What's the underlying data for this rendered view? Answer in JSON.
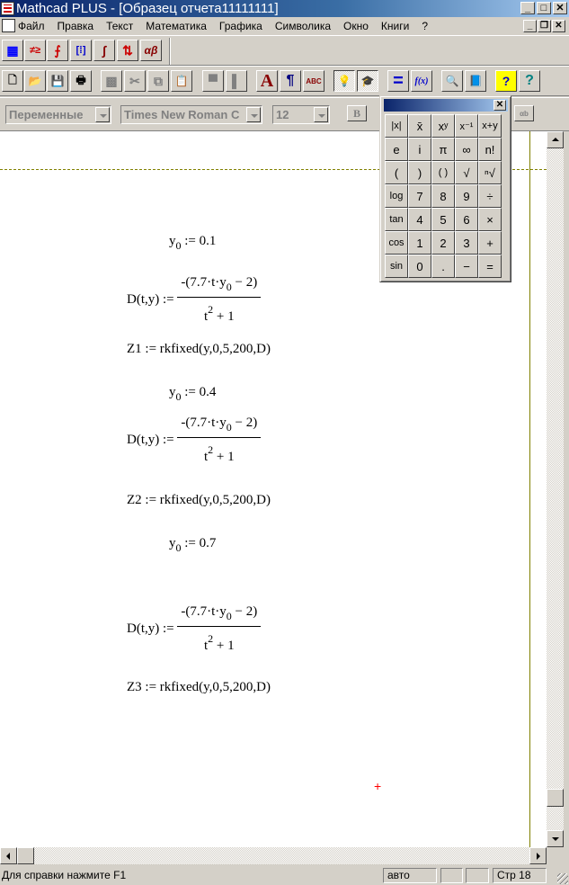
{
  "window": {
    "title": "Mathcad PLUS - [Образец  отчета11111111]",
    "controls": {
      "minimize": "_",
      "maximize": "□",
      "close": "✕"
    },
    "mdi_controls": {
      "minimize": "_",
      "restore": "❐",
      "close": "✕"
    }
  },
  "menu": {
    "items": [
      {
        "label": "Файл"
      },
      {
        "label": "Правка"
      },
      {
        "label": "Текст"
      },
      {
        "label": "Математика"
      },
      {
        "label": "Графика"
      },
      {
        "label": "Символика"
      },
      {
        "label": "Окно"
      },
      {
        "label": "Книги"
      },
      {
        "label": "?"
      }
    ]
  },
  "math_toolbar": {
    "buttons": [
      {
        "icon": "calculator-icon",
        "glyph": "▦"
      },
      {
        "icon": "evaluation-icon",
        "glyph": "≠≥"
      },
      {
        "icon": "graph-icon",
        "glyph": "⨍"
      },
      {
        "icon": "matrix-icon",
        "glyph": "[⁞]"
      },
      {
        "icon": "calculus-icon",
        "glyph": "∫"
      },
      {
        "icon": "programming-icon",
        "glyph": "⇅"
      },
      {
        "icon": "greek-icon",
        "glyph": "αβ"
      }
    ]
  },
  "standard_toolbar": {
    "buttons": [
      {
        "icon": "new-icon",
        "glyph": "🗋"
      },
      {
        "icon": "open-icon",
        "glyph": "📂"
      },
      {
        "icon": "save-icon",
        "glyph": "💾"
      },
      {
        "icon": "print-icon",
        "glyph": "🖶"
      },
      {
        "icon": "check-spelling-region-icon",
        "glyph": "▩"
      },
      {
        "icon": "cut-icon",
        "glyph": "✂"
      },
      {
        "icon": "copy-icon",
        "glyph": "⧉"
      },
      {
        "icon": "paste-icon",
        "glyph": "📋"
      },
      {
        "icon": "align-across-icon",
        "glyph": "▀"
      },
      {
        "icon": "align-down-icon",
        "glyph": "▌"
      },
      {
        "icon": "text-style-icon",
        "glyph": "A"
      },
      {
        "icon": "paragraph-icon",
        "glyph": "¶"
      },
      {
        "icon": "spellcheck-icon",
        "glyph": "ABC"
      },
      {
        "icon": "lightbulb-icon",
        "glyph": "💡"
      },
      {
        "icon": "tutor-icon",
        "glyph": "🎓"
      },
      {
        "icon": "calculate-icon",
        "glyph": "="
      },
      {
        "icon": "function-icon",
        "glyph": "f(x)"
      },
      {
        "icon": "zoom-icon",
        "glyph": "🔍"
      },
      {
        "icon": "resource-icon",
        "glyph": "📘"
      },
      {
        "icon": "help-context-icon",
        "glyph": "?"
      },
      {
        "icon": "help-icon",
        "glyph": "?"
      }
    ]
  },
  "format_toolbar": {
    "style": "Переменные",
    "font": "Times New Roman C",
    "size": "12",
    "bold_label": "B",
    "subscript_label": "αb"
  },
  "palette": {
    "keys": [
      "|x|",
      "x̄",
      "xʸ",
      "x⁻¹",
      "x+y",
      "e",
      "i",
      "π",
      "∞",
      "n!",
      "(",
      ")",
      "( )",
      "√",
      "ⁿ√",
      "log",
      "7",
      "8",
      "9",
      "÷",
      "tan",
      "4",
      "5",
      "6",
      "×",
      "cos",
      "1",
      "2",
      "3",
      "+",
      "sin",
      "0",
      ".",
      "−",
      "="
    ]
  },
  "document": {
    "blocks": [
      {
        "y0": "0.1",
        "z": "Z1 := rkfixed(y,0,5,200,D)"
      },
      {
        "y0": "0.4",
        "z": "Z2 := rkfixed(y,0,5,200,D)"
      },
      {
        "y0": "0.7",
        "z": "Z3 := rkfixed(y,0,5,200,D)"
      }
    ],
    "y_lhs": "y",
    "y_sub": "0",
    "assign": " := ",
    "d_lhs": "D(t,y) := ",
    "numerator": "-(7.7·t·y",
    "numerator_sub": "0",
    "numerator_end": " − 2)",
    "denominator": "t",
    "denominator_sup": "2",
    "denominator_end": " + 1",
    "cursor": "+"
  },
  "statusbar": {
    "help": "Для справки нажмите F1",
    "mode": "авто",
    "page": "Стр 18"
  }
}
